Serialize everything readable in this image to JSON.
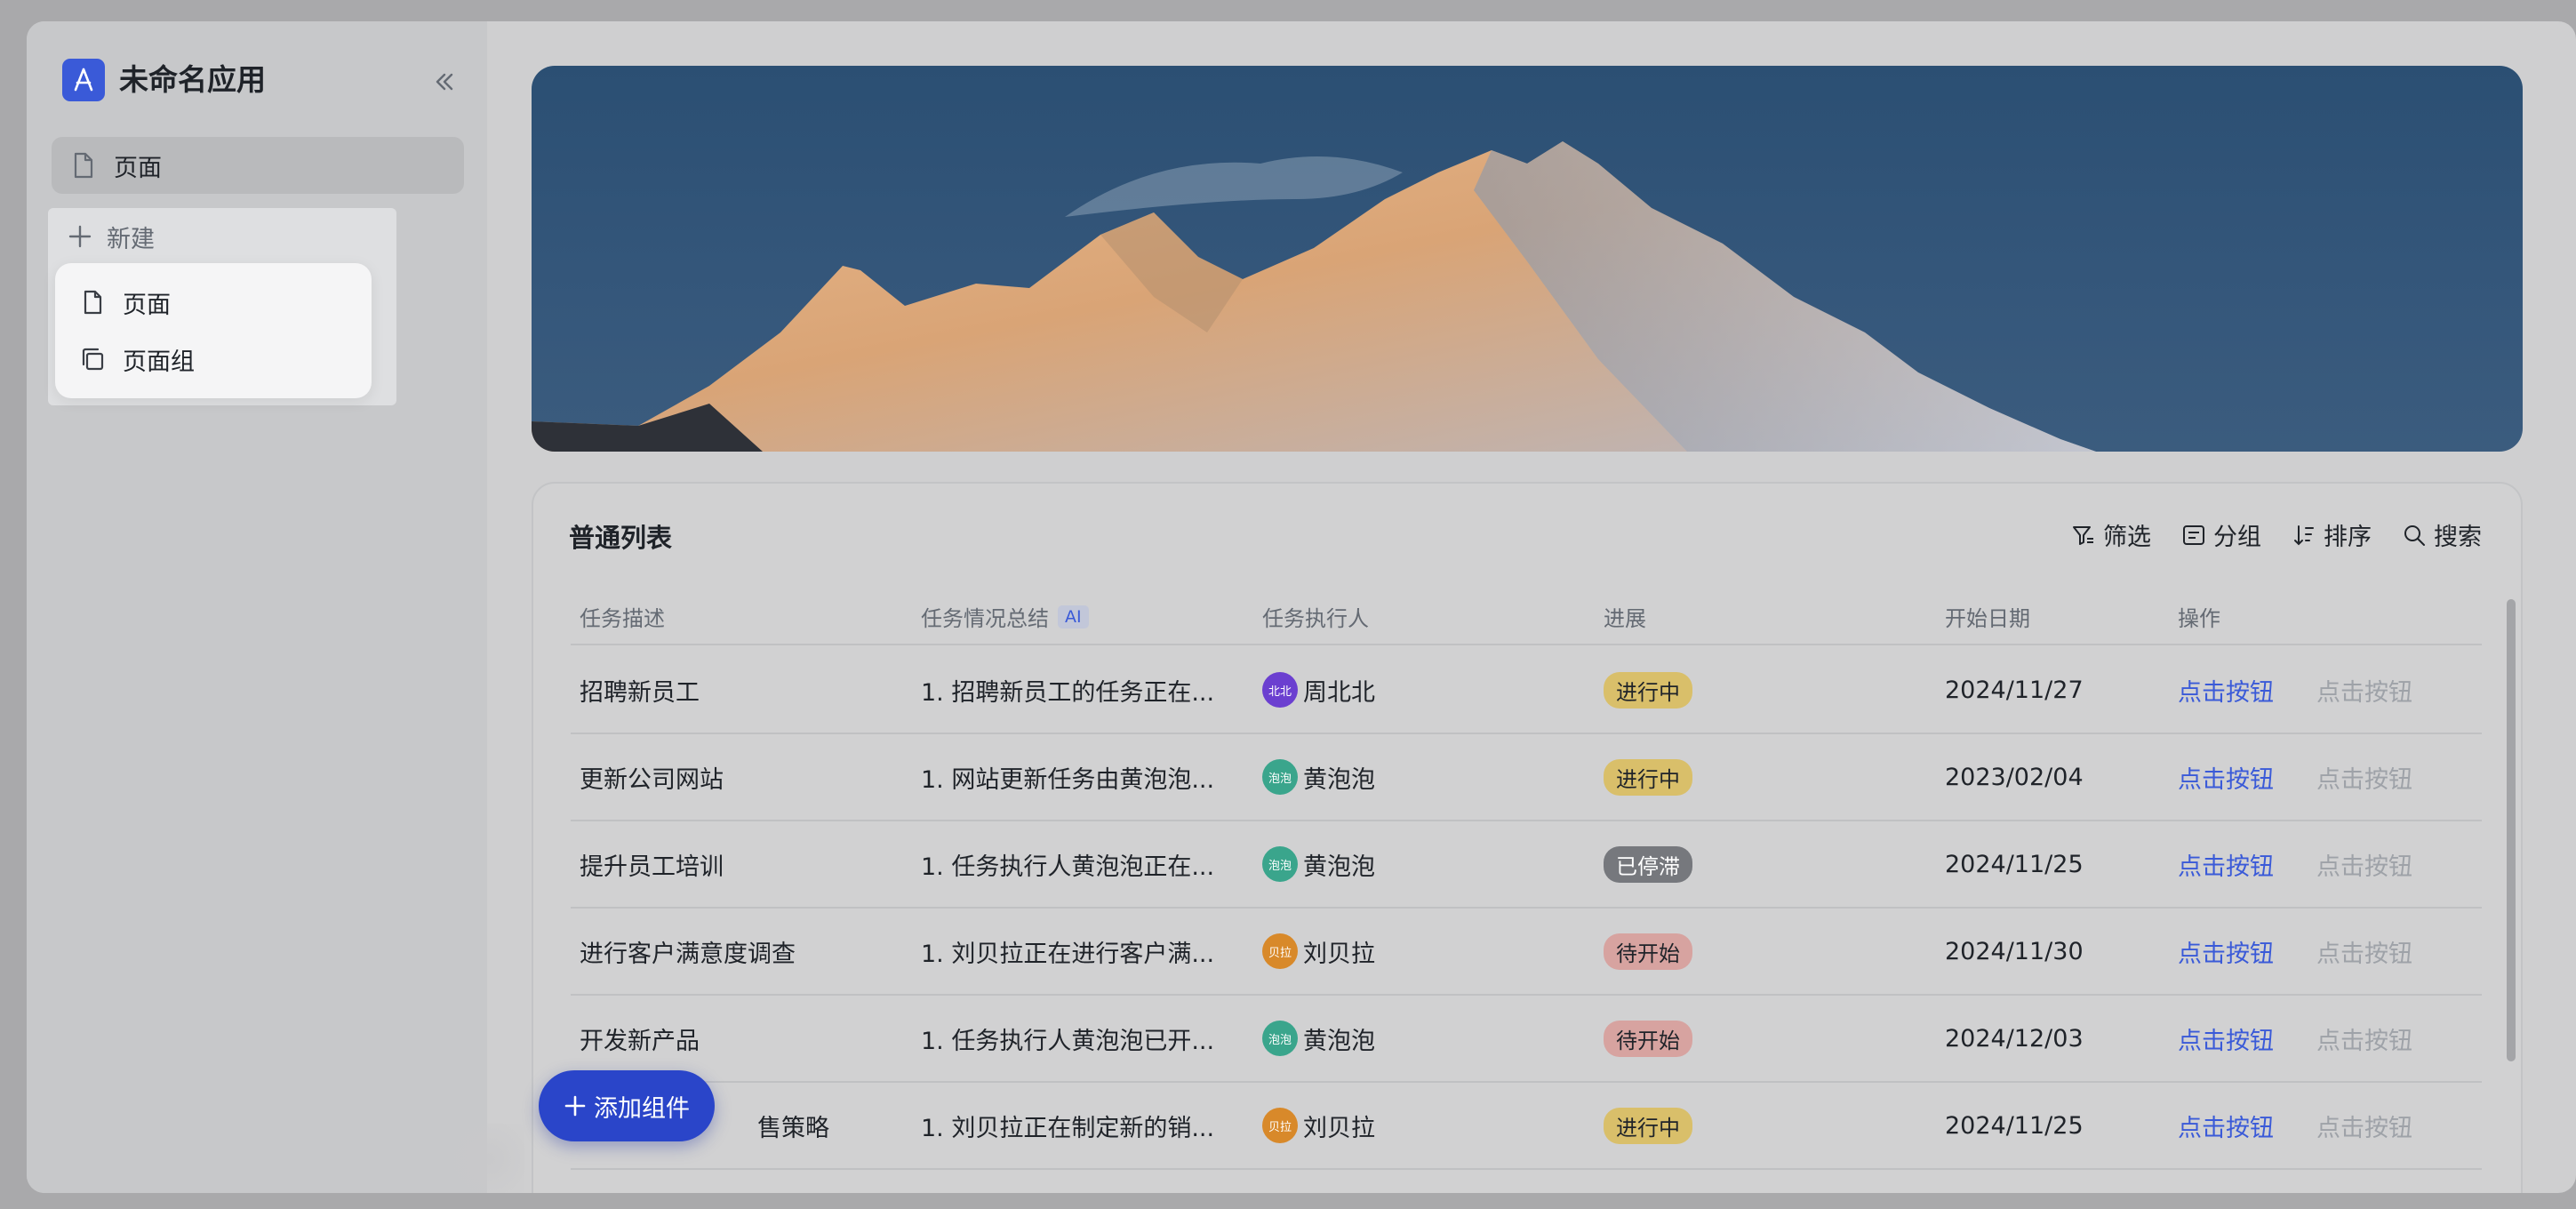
{
  "app": {
    "title": "未命名应用"
  },
  "sidebar": {
    "nav_items": [
      {
        "label": "页面"
      }
    ],
    "new_label": "新建",
    "new_menu": [
      {
        "label": "页面"
      },
      {
        "label": "页面组"
      }
    ]
  },
  "list": {
    "title": "普通列表",
    "toolbar": {
      "filter": "筛选",
      "group": "分组",
      "sort": "排序",
      "search": "搜索"
    },
    "columns": [
      "任务描述",
      "任务情况总结",
      "任务执行人",
      "进展",
      "开始日期",
      "操作"
    ],
    "ai_badge": "AI",
    "rows": [
      {
        "task": "招聘新员工",
        "summary": "1. 招聘新员工的任务正在...",
        "avatar_text": "北北",
        "assignee": "周北北",
        "status": "进行中",
        "date": "2024/11/27",
        "action1": "点击按钮",
        "action2": "点击按钮"
      },
      {
        "task": "更新公司网站",
        "summary": "1. 网站更新任务由黄泡泡...",
        "avatar_text": "泡泡",
        "assignee": "黄泡泡",
        "status": "进行中",
        "date": "2023/02/04",
        "action1": "点击按钮",
        "action2": "点击按钮"
      },
      {
        "task": "提升员工培训",
        "summary": "1. 任务执行人黄泡泡正在...",
        "avatar_text": "泡泡",
        "assignee": "黄泡泡",
        "status": "已停滞",
        "date": "2024/11/25",
        "action1": "点击按钮",
        "action2": "点击按钮"
      },
      {
        "task": "进行客户满意度调查",
        "summary": "1. 刘贝拉正在进行客户满...",
        "avatar_text": "贝拉",
        "assignee": "刘贝拉",
        "status": "待开始",
        "date": "2024/11/30",
        "action1": "点击按钮",
        "action2": "点击按钮"
      },
      {
        "task": "开发新产品",
        "summary": "1. 任务执行人黄泡泡已开...",
        "avatar_text": "泡泡",
        "assignee": "黄泡泡",
        "status": "待开始",
        "date": "2024/12/03",
        "action1": "点击按钮",
        "action2": "点击按钮"
      },
      {
        "task": "售策略",
        "summary": "1. 刘贝拉正在制定新的销...",
        "avatar_text": "贝拉",
        "assignee": "刘贝拉",
        "status": "进行中",
        "date": "2024/11/25",
        "action1": "点击按钮",
        "action2": "点击按钮"
      }
    ]
  },
  "fab": {
    "label": "添加组件"
  },
  "colors": {
    "accent": "#3a5ad8",
    "fab": "#2a45c9",
    "status_in_progress": "#d9bf6a",
    "status_stalled": "#76787d",
    "status_pending": "#d7a3a0",
    "avatar_zhou": "#6b3fd0",
    "avatar_huang": "#3aa58c",
    "avatar_liu": "#d8892a"
  }
}
